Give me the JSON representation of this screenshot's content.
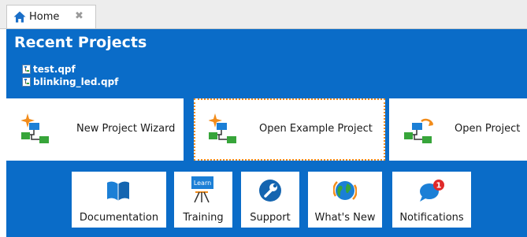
{
  "tab": {
    "label": "Home",
    "close_glyph": "✖"
  },
  "recent": {
    "title": "Recent Projects",
    "files": [
      "test.qpf",
      "blinking_led.qpf"
    ]
  },
  "actions": {
    "new_project_wizard": "New Project Wizard",
    "open_example_project": "Open Example Project",
    "open_project": "Open Project"
  },
  "resources": {
    "documentation": "Documentation",
    "training": "Training",
    "training_badge": "Learn",
    "support": "Support",
    "whats_new": "What's New",
    "notifications": "Notifications",
    "notification_count": "1"
  },
  "colors": {
    "panel_blue": "#0a6cc8",
    "accent_orange": "#f28c1a",
    "icon_blue": "#1b7fd6",
    "icon_green": "#37a53a",
    "notification_red": "#e02a2a"
  },
  "icons": {
    "tab": "home-icon",
    "recent_file": "project-file-icon",
    "new_project_wizard": "hierarchy-sparkle-icon",
    "open_example_project": "hierarchy-sparkle-icon",
    "open_project": "hierarchy-open-icon",
    "documentation": "book-icon",
    "training": "presentation-board-icon",
    "support": "wrench-icon",
    "whats_new": "globe-icon",
    "notifications": "chat-bubble-icon"
  }
}
